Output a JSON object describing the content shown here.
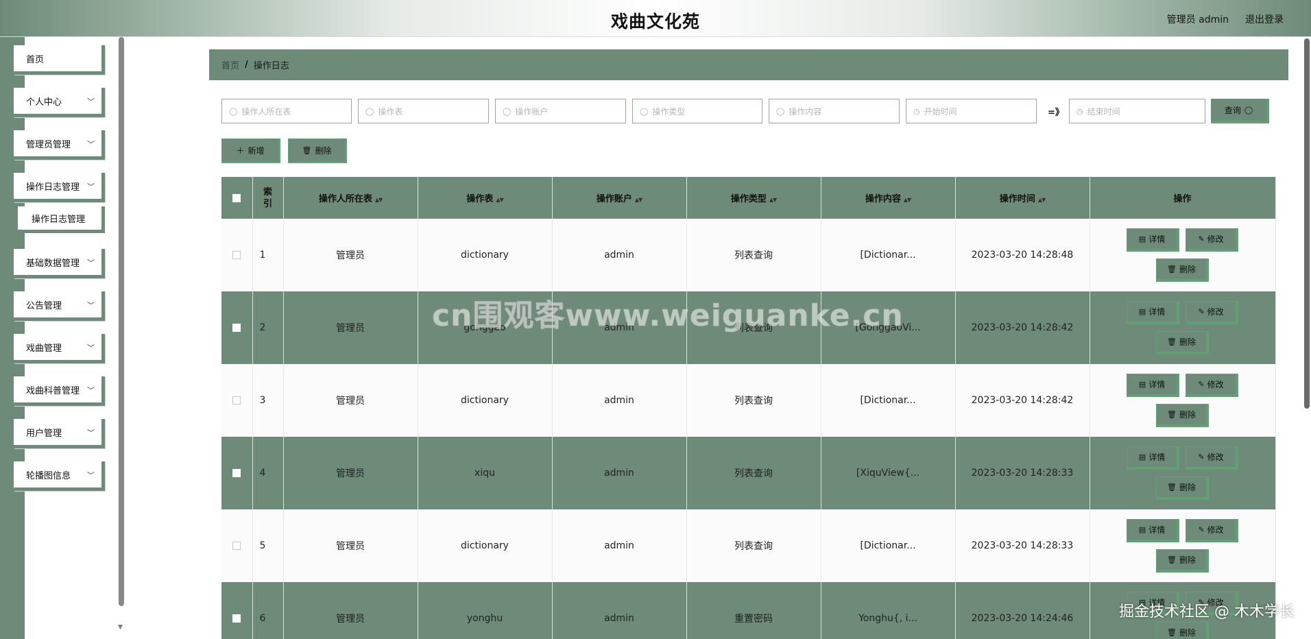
{
  "header": {
    "title": "戏曲文化苑",
    "user": "管理员 admin",
    "logout": "退出登录"
  },
  "sidebar": {
    "items": [
      {
        "label": "首页",
        "chevron": false
      },
      {
        "label": "个人中心",
        "chevron": true
      },
      {
        "label": "管理员管理",
        "chevron": true
      },
      {
        "label": "操作日志管理",
        "chevron": true
      },
      {
        "label": "基础数据管理",
        "chevron": true
      },
      {
        "label": "公告管理",
        "chevron": true
      },
      {
        "label": "戏曲管理",
        "chevron": true
      },
      {
        "label": "戏曲科普管理",
        "chevron": true
      },
      {
        "label": "用户管理",
        "chevron": true
      },
      {
        "label": "轮播图信息",
        "chevron": true
      }
    ],
    "submenu": {
      "label": "操作日志管理"
    }
  },
  "breadcrumb": {
    "home": "首页",
    "separator": "/",
    "current": "操作日志"
  },
  "search": {
    "placeholders": [
      "操作人所在表",
      "操作表",
      "操作账户",
      "操作类型",
      "操作内容",
      "开始时间",
      "结束时间"
    ],
    "range_separator": "=》",
    "query_label": "查询"
  },
  "actions": {
    "add_label": "新增",
    "delete_label": "删除"
  },
  "table": {
    "headers": [
      "索引",
      "操作人所在表",
      "操作表",
      "操作账户",
      "操作类型",
      "操作内容",
      "操作时间",
      "操作"
    ],
    "op_labels": {
      "detail": "详情",
      "edit": "修改",
      "delete": "删除"
    },
    "rows": [
      {
        "index": "1",
        "role": "管理员",
        "table": "dictionary",
        "account": "admin",
        "type": "列表查询",
        "content": "[Dictionar...",
        "time": "2023-03-20 14:28:48"
      },
      {
        "index": "2",
        "role": "管理员",
        "table": "gonggao",
        "account": "admin",
        "type": "列表查询",
        "content": "[GonggaoVi...",
        "time": "2023-03-20 14:28:42"
      },
      {
        "index": "3",
        "role": "管理员",
        "table": "dictionary",
        "account": "admin",
        "type": "列表查询",
        "content": "[Dictionar...",
        "time": "2023-03-20 14:28:42"
      },
      {
        "index": "4",
        "role": "管理员",
        "table": "xiqu",
        "account": "admin",
        "type": "列表查询",
        "content": "[XiquView{...",
        "time": "2023-03-20 14:28:33"
      },
      {
        "index": "5",
        "role": "管理员",
        "table": "dictionary",
        "account": "admin",
        "type": "列表查询",
        "content": "[Dictionar...",
        "time": "2023-03-20 14:28:33"
      },
      {
        "index": "6",
        "role": "管理员",
        "table": "yonghu",
        "account": "admin",
        "type": "重置密码",
        "content": "Yonghu{, i...",
        "time": "2023-03-20 14:24:46"
      }
    ]
  },
  "watermarks": {
    "center": "cn围观客www.weiguanke.cn",
    "corner": "掘金技术社区 @ 木木学长"
  },
  "colors": {
    "accent": "#6e8a78",
    "border_accent": "#5fa074"
  }
}
